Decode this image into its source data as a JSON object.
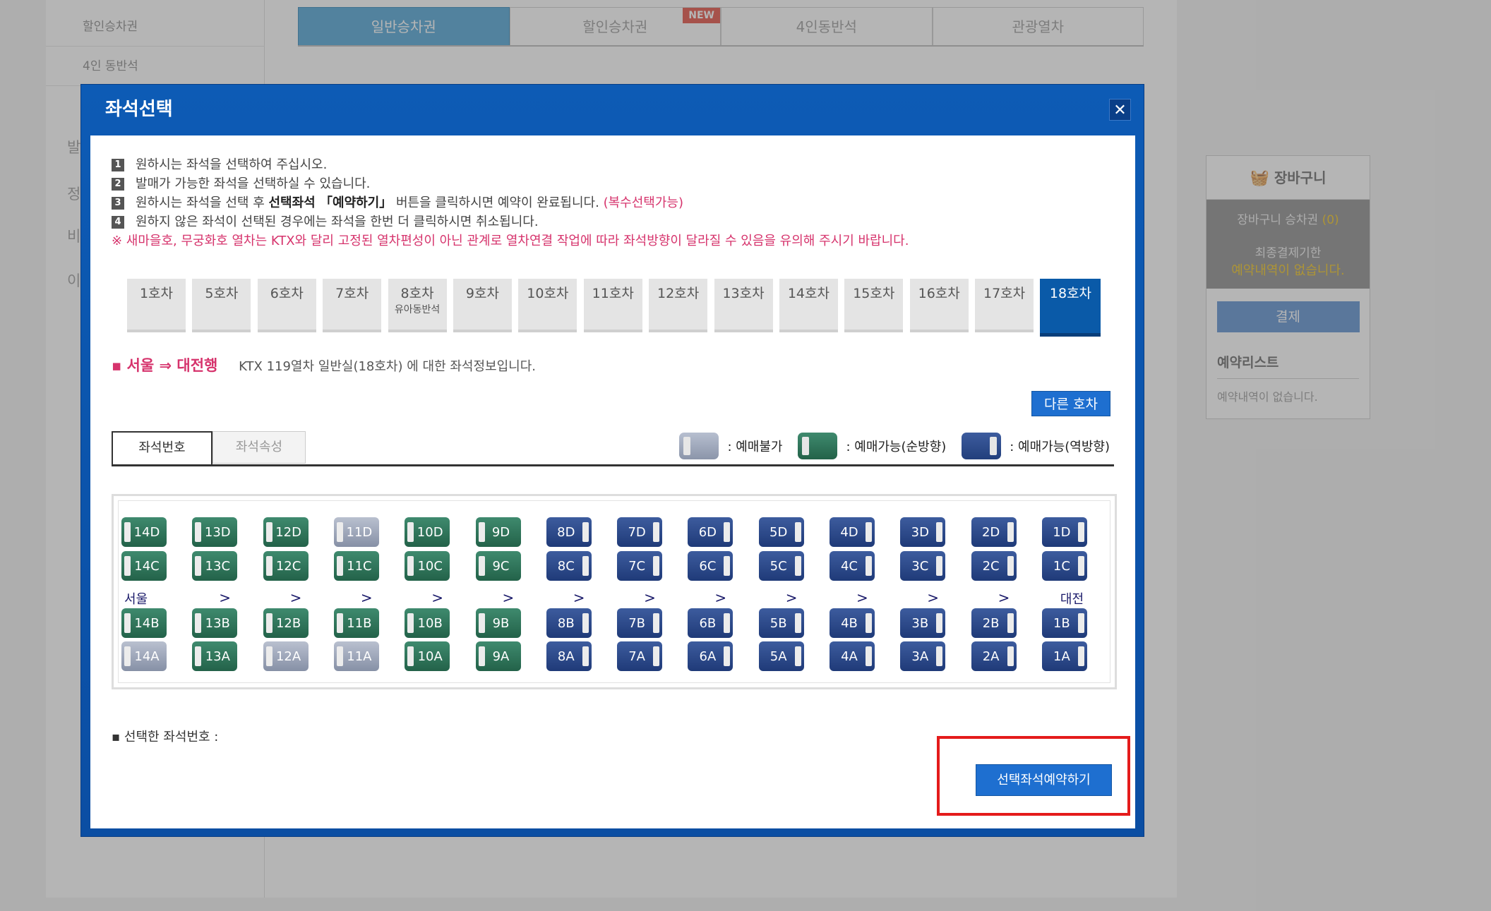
{
  "background": {
    "sidebar_items": [
      "할인승차권",
      "4인 동반석"
    ],
    "sidebar_big_letters": [
      "발",
      "정",
      "비",
      "이"
    ],
    "tabs": [
      {
        "label": "일반승차권",
        "active": true
      },
      {
        "label": "할인승차권",
        "badge": "NEW"
      },
      {
        "label": "4인동반석"
      },
      {
        "label": "관광열차"
      }
    ],
    "cart": {
      "title": "장바구니",
      "count_label": "장바구니 승차권",
      "count_value": "(0)",
      "deadline_label": "최종결제기한",
      "deadline_value": "예약내역이 없습니다.",
      "pay_button": "결제",
      "list_title": "예약리스트",
      "list_empty": "예약내역이 없습니다."
    }
  },
  "modal": {
    "title": "좌석선택",
    "close_icon": "close-icon",
    "instructions": {
      "line1": {
        "num": "1",
        "text": "원하시는 좌석을 선택하여 주십시오."
      },
      "line2": {
        "num": "2",
        "text": "발매가 가능한 좌석을 선택하실 수 있습니다."
      },
      "line3": {
        "num": "3",
        "pre": "원하시는 좌석을 선택 후",
        "bold": "선택좌석 「예약하기」",
        "post": "버튼을 클릭하시면 예약이 완료됩니다.",
        "note": "(복수선택가능)"
      },
      "line4": {
        "num": "4",
        "text": "원하지 않은 좌석이 선택된 경우에는 좌석을 한번 더 클릭하시면 취소됩니다."
      },
      "warning": "※ 새마을호, 무궁화호 열차는 KTX와 달리 고정된 열차편성이 아닌 관계로 열차연결 작업에 따라 좌석방향이 달라질 수 있음을 유의해 주시기 바랍니다."
    },
    "cars": [
      {
        "label": "1호차"
      },
      {
        "label": "5호차"
      },
      {
        "label": "6호차"
      },
      {
        "label": "7호차"
      },
      {
        "label": "8호차",
        "sub": "유아동반석"
      },
      {
        "label": "9호차"
      },
      {
        "label": "10호차"
      },
      {
        "label": "11호차"
      },
      {
        "label": "12호차"
      },
      {
        "label": "13호차"
      },
      {
        "label": "14호차"
      },
      {
        "label": "15호차"
      },
      {
        "label": "16호차"
      },
      {
        "label": "17호차"
      },
      {
        "label": "18호차",
        "active": true
      }
    ],
    "route": "▪ 서울 ⇒ 대전행",
    "route_info": "KTX 119열차   일반실(18호차) 에 대한 좌석정보입니다.",
    "other_car_button": "다른 호차",
    "sub_tabs": {
      "seat_number": "좌석번호",
      "seat_attr": "좌석속성"
    },
    "legend": {
      "unavailable": ": 예매불가",
      "forward": ": 예매가능(순방향)",
      "reverse": ": 예매가능(역방향)"
    },
    "direction": {
      "from": "서울",
      "to": "대전",
      "arrow": ">"
    },
    "seat_rows": {
      "D": [
        "14D",
        "13D",
        "12D",
        "11D",
        "10D",
        "9D",
        "8D",
        "7D",
        "6D",
        "5D",
        "4D",
        "3D",
        "2D",
        "1D"
      ],
      "C": [
        "14C",
        "13C",
        "12C",
        "11C",
        "10C",
        "9C",
        "8C",
        "7C",
        "6C",
        "5C",
        "4C",
        "3C",
        "2C",
        "1C"
      ],
      "B": [
        "14B",
        "13B",
        "12B",
        "11B",
        "10B",
        "9B",
        "8B",
        "7B",
        "6B",
        "5B",
        "4B",
        "3B",
        "2B",
        "1B"
      ],
      "A": [
        "14A",
        "13A",
        "12A",
        "11A",
        "10A",
        "9A",
        "8A",
        "7A",
        "6A",
        "5A",
        "4A",
        "3A",
        "2A",
        "1A"
      ]
    },
    "seat_status": {
      "D": [
        "green",
        "green",
        "green",
        "gray",
        "green",
        "green",
        "blue",
        "blue",
        "blue",
        "blue",
        "blue",
        "blue",
        "blue",
        "blue"
      ],
      "C": [
        "green",
        "green",
        "green",
        "green",
        "green",
        "green",
        "blue",
        "blue",
        "blue",
        "blue",
        "blue",
        "blue",
        "blue",
        "blue"
      ],
      "B": [
        "green",
        "green",
        "green",
        "green",
        "green",
        "green",
        "blue",
        "blue",
        "blue",
        "blue",
        "blue",
        "blue",
        "blue",
        "blue"
      ],
      "A": [
        "gray",
        "green",
        "gray",
        "gray",
        "green",
        "green",
        "blue",
        "blue",
        "blue",
        "blue",
        "blue",
        "blue",
        "blue",
        "blue"
      ]
    },
    "selected_label": "▪ 선택한 좌석번호 :",
    "reserve_button": "선택좌석예약하기"
  },
  "colors": {
    "seat_green": "#2f7a5c",
    "seat_gray": "#9aa3b7",
    "seat_blue": "#2c4a8c",
    "modal_blue": "#0d5bb5",
    "accent_pink": "#d6336c",
    "highlight_red": "#e41b1b"
  }
}
